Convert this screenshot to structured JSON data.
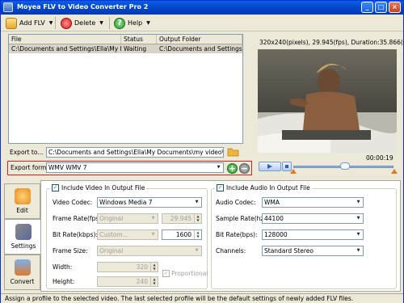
{
  "window": {
    "title": "Moyea FLV to Video Converter Pro 2",
    "minimize": "_",
    "maximize": "□",
    "close": "×"
  },
  "toolbar": {
    "add_label": "Add FLV",
    "delete_label": "Delete",
    "help_label": "Help"
  },
  "file_list": {
    "columns": [
      "File",
      "Status",
      "Output Folder"
    ],
    "rows": [
      {
        "file": "C:\\Documents and Settings\\Ella\\My Doc...",
        "status": "Waiting",
        "output": "C:\\Documents and Settings\\El..."
      }
    ]
  },
  "preview": {
    "info": "320x240(pixels), 29.945(fps), Duration:35.866(s)",
    "time": "00:00:19",
    "position": 0.52
  },
  "export": {
    "to_label": "Export to...",
    "to_value": "C:\\Documents and Settings\\Ella\\My Documents\\my video\\607[1].wm",
    "format_label": "Export format:",
    "format_value": "WMV WMV 7"
  },
  "tabs": [
    {
      "label": "Edit"
    },
    {
      "label": "Settings"
    },
    {
      "label": "Convert"
    }
  ],
  "video": {
    "include_label": "Include Video In Output File",
    "codec_label": "Video Codec:",
    "codec_value": "Windows Media 7",
    "framerate_label": "Frame Rate(fps):",
    "framerate_mode": "Original",
    "framerate_value": "29.945",
    "bitrate_label": "Bit Rate(kbps):",
    "bitrate_mode": "Custom...",
    "bitrate_value": "1600",
    "framesize_label": "Frame Size:",
    "framesize_value": "Original",
    "width_label": "Width:",
    "width_value": "320",
    "height_label": "Height:",
    "height_value": "240",
    "proportional_label": "Proportional"
  },
  "audio": {
    "include_label": "Include Audio In Output File",
    "codec_label": "Audio Codec:",
    "codec_value": "WMA",
    "samplerate_label": "Sample Rate(hz):",
    "samplerate_value": "44100",
    "bitrate_label": "Bit Rate(bps):",
    "bitrate_value": "128000",
    "channels_label": "Channels:",
    "channels_value": "Standard Stereo"
  },
  "status_text": "Assign a profile to the selected video. The last selected profile will be the default settings of newly added FLV files.",
  "colors": {
    "title_bar": "#0a5fe6",
    "highlight_box": "#e02020",
    "add_green": "#2fa32f",
    "remove_gray": "#808080"
  }
}
